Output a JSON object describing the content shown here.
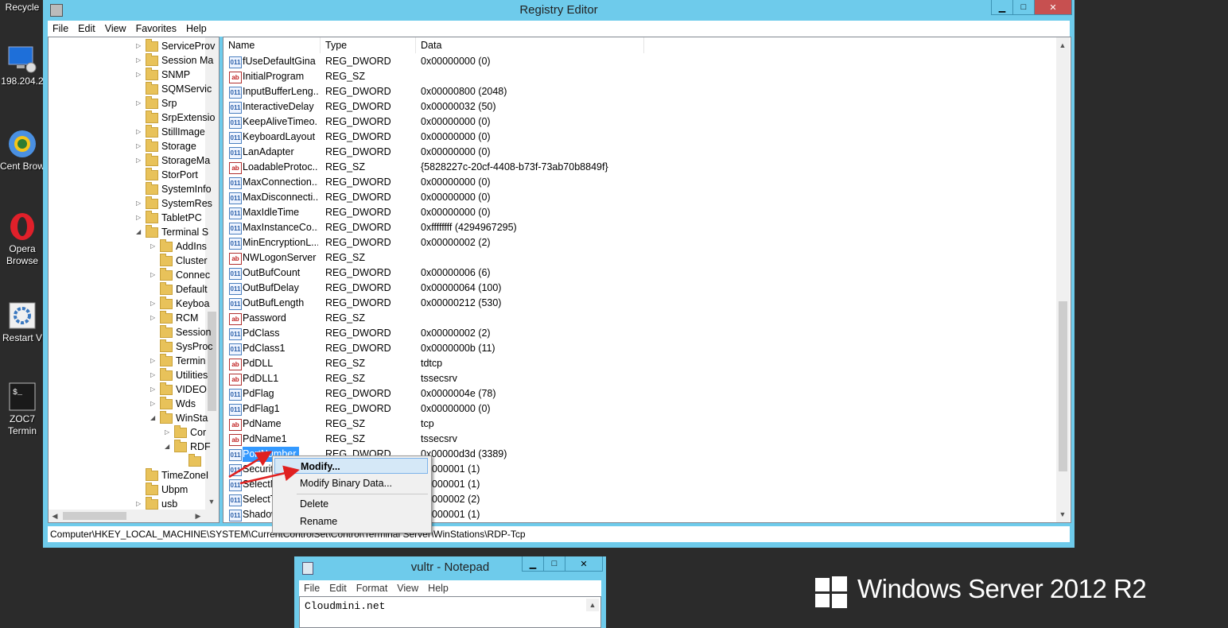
{
  "desktop": {
    "icons": [
      {
        "label": "Recycle",
        "icon": "recycle-bin-icon"
      },
      {
        "label": "198.204.2",
        "icon": "remote-desktop-icon"
      },
      {
        "label": "Cent Brow",
        "icon": "chrome-icon"
      },
      {
        "label": "Opera Browse",
        "icon": "opera-icon"
      },
      {
        "label": "Restart V",
        "icon": "gear-icon"
      },
      {
        "label": "ZOC7 Termin",
        "icon": "terminal-icon"
      }
    ],
    "brand_text": "Windows Server 2012 R2"
  },
  "regedit": {
    "title": "Registry Editor",
    "menu": [
      "File",
      "Edit",
      "View",
      "Favorites",
      "Help"
    ],
    "tree": [
      {
        "label": "ServiceProv",
        "indent": 0,
        "exp": "▷"
      },
      {
        "label": "Session Ma",
        "indent": 0,
        "exp": "▷"
      },
      {
        "label": "SNMP",
        "indent": 0,
        "exp": "▷"
      },
      {
        "label": "SQMServic",
        "indent": 0,
        "exp": ""
      },
      {
        "label": "Srp",
        "indent": 0,
        "exp": "▷"
      },
      {
        "label": "SrpExtensio",
        "indent": 0,
        "exp": ""
      },
      {
        "label": "StillImage",
        "indent": 0,
        "exp": "▷"
      },
      {
        "label": "Storage",
        "indent": 0,
        "exp": "▷"
      },
      {
        "label": "StorageMa",
        "indent": 0,
        "exp": "▷"
      },
      {
        "label": "StorPort",
        "indent": 0,
        "exp": ""
      },
      {
        "label": "SystemInfo",
        "indent": 0,
        "exp": ""
      },
      {
        "label": "SystemRes",
        "indent": 0,
        "exp": "▷"
      },
      {
        "label": "TabletPC",
        "indent": 0,
        "exp": "▷"
      },
      {
        "label": "Terminal S",
        "indent": 0,
        "exp": "◢"
      },
      {
        "label": "AddIns",
        "indent": 1,
        "exp": "▷"
      },
      {
        "label": "Cluster",
        "indent": 1,
        "exp": ""
      },
      {
        "label": "Connec",
        "indent": 1,
        "exp": "▷"
      },
      {
        "label": "Default",
        "indent": 1,
        "exp": ""
      },
      {
        "label": "Keyboa",
        "indent": 1,
        "exp": "▷"
      },
      {
        "label": "RCM",
        "indent": 1,
        "exp": "▷"
      },
      {
        "label": "Session",
        "indent": 1,
        "exp": ""
      },
      {
        "label": "SysProc",
        "indent": 1,
        "exp": ""
      },
      {
        "label": "Termin",
        "indent": 1,
        "exp": "▷"
      },
      {
        "label": "Utilities",
        "indent": 1,
        "exp": "▷"
      },
      {
        "label": "VIDEO",
        "indent": 1,
        "exp": "▷"
      },
      {
        "label": "Wds",
        "indent": 1,
        "exp": "▷"
      },
      {
        "label": "WinSta",
        "indent": 1,
        "exp": "◢"
      },
      {
        "label": "Cor",
        "indent": 2,
        "exp": "▷"
      },
      {
        "label": "RDF",
        "indent": 2,
        "exp": "◢"
      },
      {
        "label": "",
        "indent": 3,
        "exp": ""
      },
      {
        "label": "TimeZoneI",
        "indent": 0,
        "exp": ""
      },
      {
        "label": "Ubpm",
        "indent": 0,
        "exp": ""
      },
      {
        "label": "usb",
        "indent": 0,
        "exp": "▷"
      }
    ],
    "columns": {
      "name": "Name",
      "type": "Type",
      "data": "Data"
    },
    "values": [
      {
        "name": "fUseDefaultGina",
        "type": "REG_DWORD",
        "data": "0x00000000 (0)",
        "kind": "bin"
      },
      {
        "name": "InitialProgram",
        "type": "REG_SZ",
        "data": "",
        "kind": "str"
      },
      {
        "name": "InputBufferLeng...",
        "type": "REG_DWORD",
        "data": "0x00000800 (2048)",
        "kind": "bin"
      },
      {
        "name": "InteractiveDelay",
        "type": "REG_DWORD",
        "data": "0x00000032 (50)",
        "kind": "bin"
      },
      {
        "name": "KeepAliveTimeo...",
        "type": "REG_DWORD",
        "data": "0x00000000 (0)",
        "kind": "bin"
      },
      {
        "name": "KeyboardLayout",
        "type": "REG_DWORD",
        "data": "0x00000000 (0)",
        "kind": "bin"
      },
      {
        "name": "LanAdapter",
        "type": "REG_DWORD",
        "data": "0x00000000 (0)",
        "kind": "bin"
      },
      {
        "name": "LoadableProtoc...",
        "type": "REG_SZ",
        "data": "{5828227c-20cf-4408-b73f-73ab70b8849f}",
        "kind": "str"
      },
      {
        "name": "MaxConnection...",
        "type": "REG_DWORD",
        "data": "0x00000000 (0)",
        "kind": "bin"
      },
      {
        "name": "MaxDisconnecti...",
        "type": "REG_DWORD",
        "data": "0x00000000 (0)",
        "kind": "bin"
      },
      {
        "name": "MaxIdleTime",
        "type": "REG_DWORD",
        "data": "0x00000000 (0)",
        "kind": "bin"
      },
      {
        "name": "MaxInstanceCo...",
        "type": "REG_DWORD",
        "data": "0xffffffff (4294967295)",
        "kind": "bin"
      },
      {
        "name": "MinEncryptionL...",
        "type": "REG_DWORD",
        "data": "0x00000002 (2)",
        "kind": "bin"
      },
      {
        "name": "NWLogonServer",
        "type": "REG_SZ",
        "data": "",
        "kind": "str"
      },
      {
        "name": "OutBufCount",
        "type": "REG_DWORD",
        "data": "0x00000006 (6)",
        "kind": "bin"
      },
      {
        "name": "OutBufDelay",
        "type": "REG_DWORD",
        "data": "0x00000064 (100)",
        "kind": "bin"
      },
      {
        "name": "OutBufLength",
        "type": "REG_DWORD",
        "data": "0x00000212 (530)",
        "kind": "bin"
      },
      {
        "name": "Password",
        "type": "REG_SZ",
        "data": "",
        "kind": "str"
      },
      {
        "name": "PdClass",
        "type": "REG_DWORD",
        "data": "0x00000002 (2)",
        "kind": "bin"
      },
      {
        "name": "PdClass1",
        "type": "REG_DWORD",
        "data": "0x0000000b (11)",
        "kind": "bin"
      },
      {
        "name": "PdDLL",
        "type": "REG_SZ",
        "data": "tdtcp",
        "kind": "str"
      },
      {
        "name": "PdDLL1",
        "type": "REG_SZ",
        "data": "tssecsrv",
        "kind": "str"
      },
      {
        "name": "PdFlag",
        "type": "REG_DWORD",
        "data": "0x0000004e (78)",
        "kind": "bin"
      },
      {
        "name": "PdFlag1",
        "type": "REG_DWORD",
        "data": "0x00000000 (0)",
        "kind": "bin"
      },
      {
        "name": "PdName",
        "type": "REG_SZ",
        "data": "tcp",
        "kind": "str"
      },
      {
        "name": "PdName1",
        "type": "REG_SZ",
        "data": "tssecsrv",
        "kind": "str"
      },
      {
        "name": "PortNumber",
        "type": "REG_DWORD",
        "data": "0x00000d3d (3389)",
        "kind": "bin",
        "selected": true
      },
      {
        "name": "Securit",
        "type": "",
        "data": "00000001 (1)",
        "kind": "bin"
      },
      {
        "name": "SelectN",
        "type": "",
        "data": "00000001 (1)",
        "kind": "bin"
      },
      {
        "name": "SelectT",
        "type": "",
        "data": "00000002 (2)",
        "kind": "bin"
      },
      {
        "name": "Shadow",
        "type": "",
        "data": "00000001 (1)",
        "kind": "bin"
      }
    ],
    "context_menu": [
      "Modify...",
      "Modify Binary Data...",
      "Delete",
      "Rename"
    ],
    "status_path": "Computer\\HKEY_LOCAL_MACHINE\\SYSTEM\\CurrentControlSet\\Control\\Terminal Server\\WinStations\\RDP-Tcp"
  },
  "notepad": {
    "title": "vultr - Notepad",
    "menu": [
      "File",
      "Edit",
      "Format",
      "View",
      "Help"
    ],
    "content": "Cloudmini.net"
  }
}
